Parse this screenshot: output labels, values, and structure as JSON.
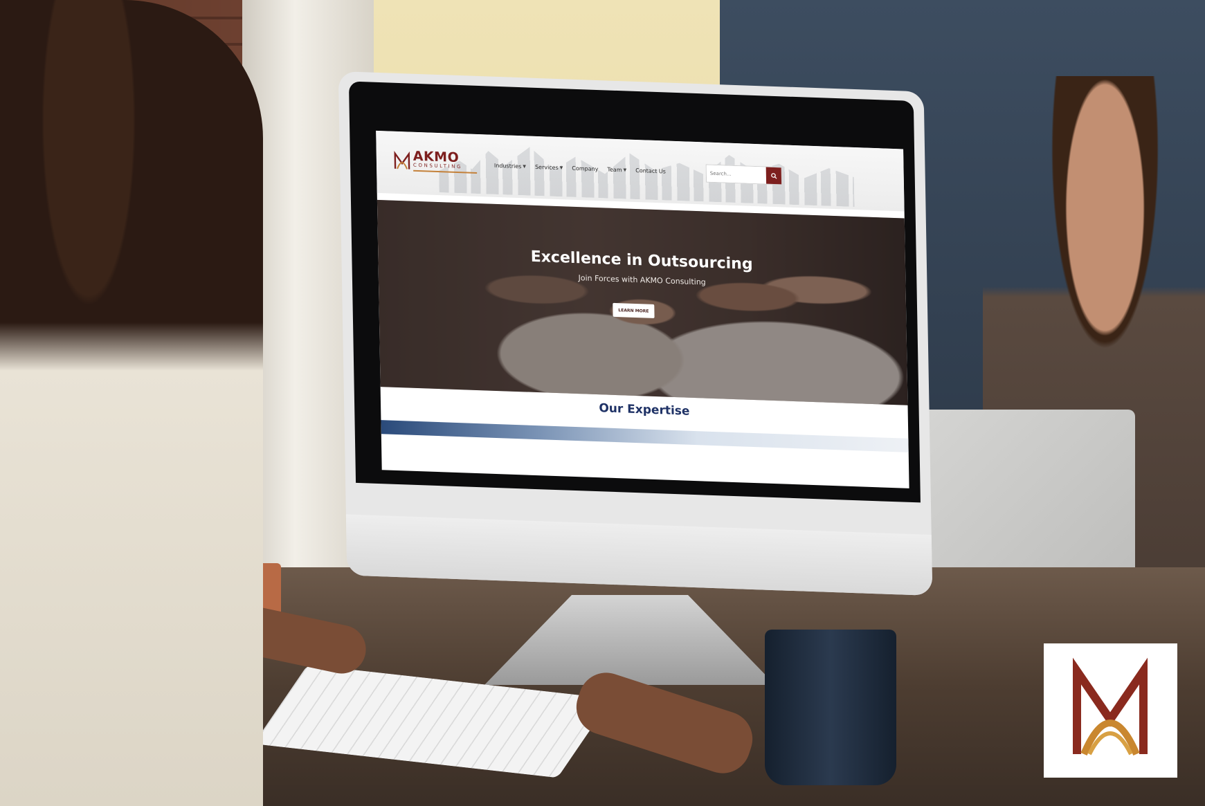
{
  "site": {
    "logo": {
      "name": "AKMO",
      "subname": "CONSULTING"
    },
    "nav": [
      {
        "label": "Industries",
        "has_dropdown": true
      },
      {
        "label": "Services",
        "has_dropdown": true
      },
      {
        "label": "Company",
        "has_dropdown": false
      },
      {
        "label": "Team",
        "has_dropdown": true
      },
      {
        "label": "Contact Us",
        "has_dropdown": false
      }
    ],
    "search": {
      "placeholder": "Search..."
    },
    "hero": {
      "title": "Excellence in Outsourcing",
      "subtitle": "Join Forces with AKMO Consulting",
      "cta": "LEARN MORE"
    },
    "section_title": "Our Expertise"
  },
  "colors": {
    "brand": "#7d1f1e",
    "accent": "#c4813a",
    "heading": "#1f3266"
  },
  "icons": {
    "search_button": "search-icon",
    "dropdown": "chevron-down-icon",
    "badge": "akmo-logo-mark"
  }
}
